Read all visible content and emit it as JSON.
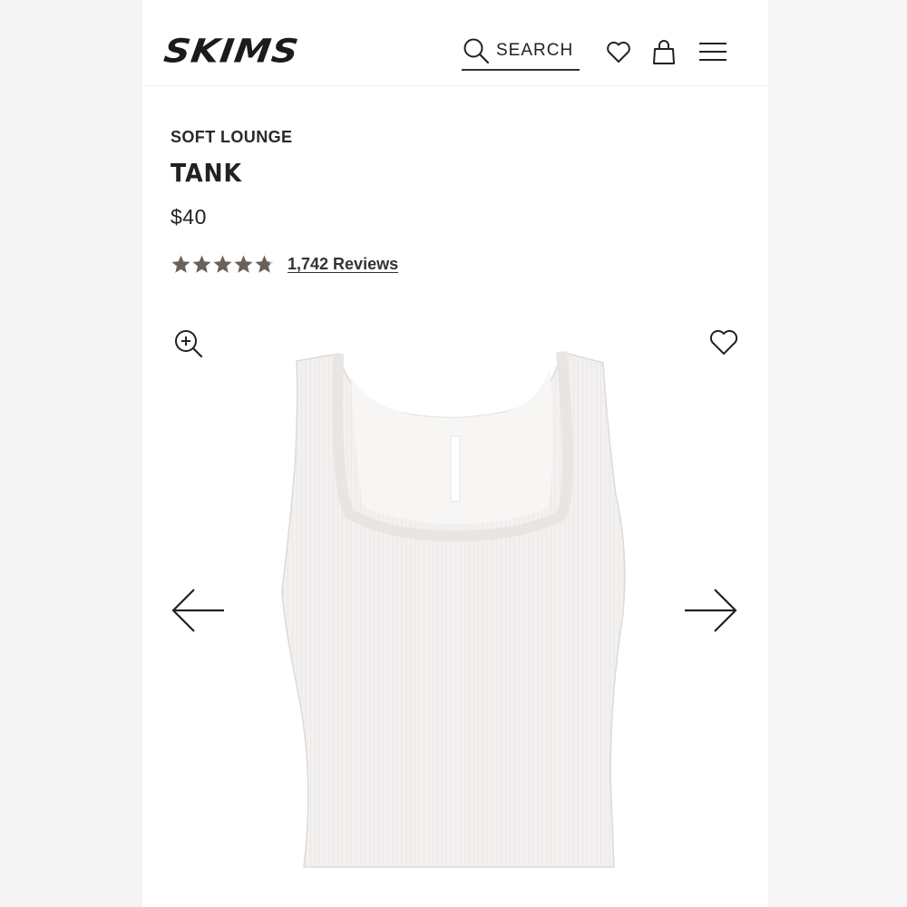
{
  "header": {
    "logo": "SKIMS",
    "search_label": "SEARCH"
  },
  "product": {
    "category": "SOFT LOUNGE",
    "name": "TANK",
    "price": "$40",
    "rating": 4.8,
    "reviews_label": "1,742 Reviews"
  },
  "icons": {
    "search": "search-icon",
    "wishlist": "heart-icon",
    "cart": "shopping-bag-icon",
    "menu": "hamburger-menu-icon",
    "zoom": "zoom-in-icon",
    "favorite": "heart-icon",
    "prev": "arrow-left-icon",
    "next": "arrow-right-icon"
  },
  "colors": {
    "star": "#6b6158",
    "text": "#222222",
    "garment": "#f3f1f0"
  }
}
